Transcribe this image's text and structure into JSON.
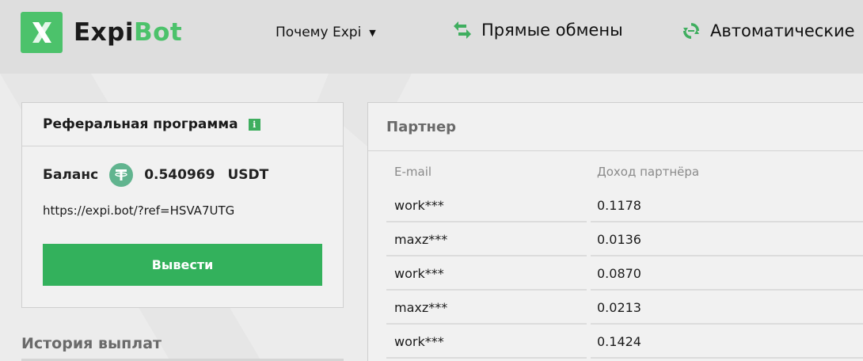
{
  "header": {
    "logo_text_1": "Expi",
    "logo_text_2": "Bot",
    "nav": {
      "why_label": "Почему Expi",
      "direct_label": "Прямые обмены",
      "auto_label": "Автоматические"
    }
  },
  "referral": {
    "title": "Реферальная программа",
    "info_glyph": "i",
    "balance_label": "Баланс",
    "balance_value": "0.540969",
    "currency": "USDT",
    "link": "https://expi.bot/?ref=HSVA7UTG",
    "withdraw_label": "Вывести"
  },
  "history": {
    "title": "История выплат"
  },
  "partner": {
    "title": "Партнер",
    "columns": {
      "email": "E-mail",
      "income": "Доход партнёра"
    },
    "rows": [
      {
        "email": "work***",
        "income": "0.1178"
      },
      {
        "email": "maxz***",
        "income": "0.0136"
      },
      {
        "email": "work***",
        "income": "0.0870"
      },
      {
        "email": "maxz***",
        "income": "0.0213"
      },
      {
        "email": "work***",
        "income": "0.1424"
      }
    ]
  },
  "colors": {
    "brand_green": "#4cc26b",
    "button_green": "#33b15c",
    "header_bg": "#dedede",
    "page_bg": "#ececec"
  }
}
